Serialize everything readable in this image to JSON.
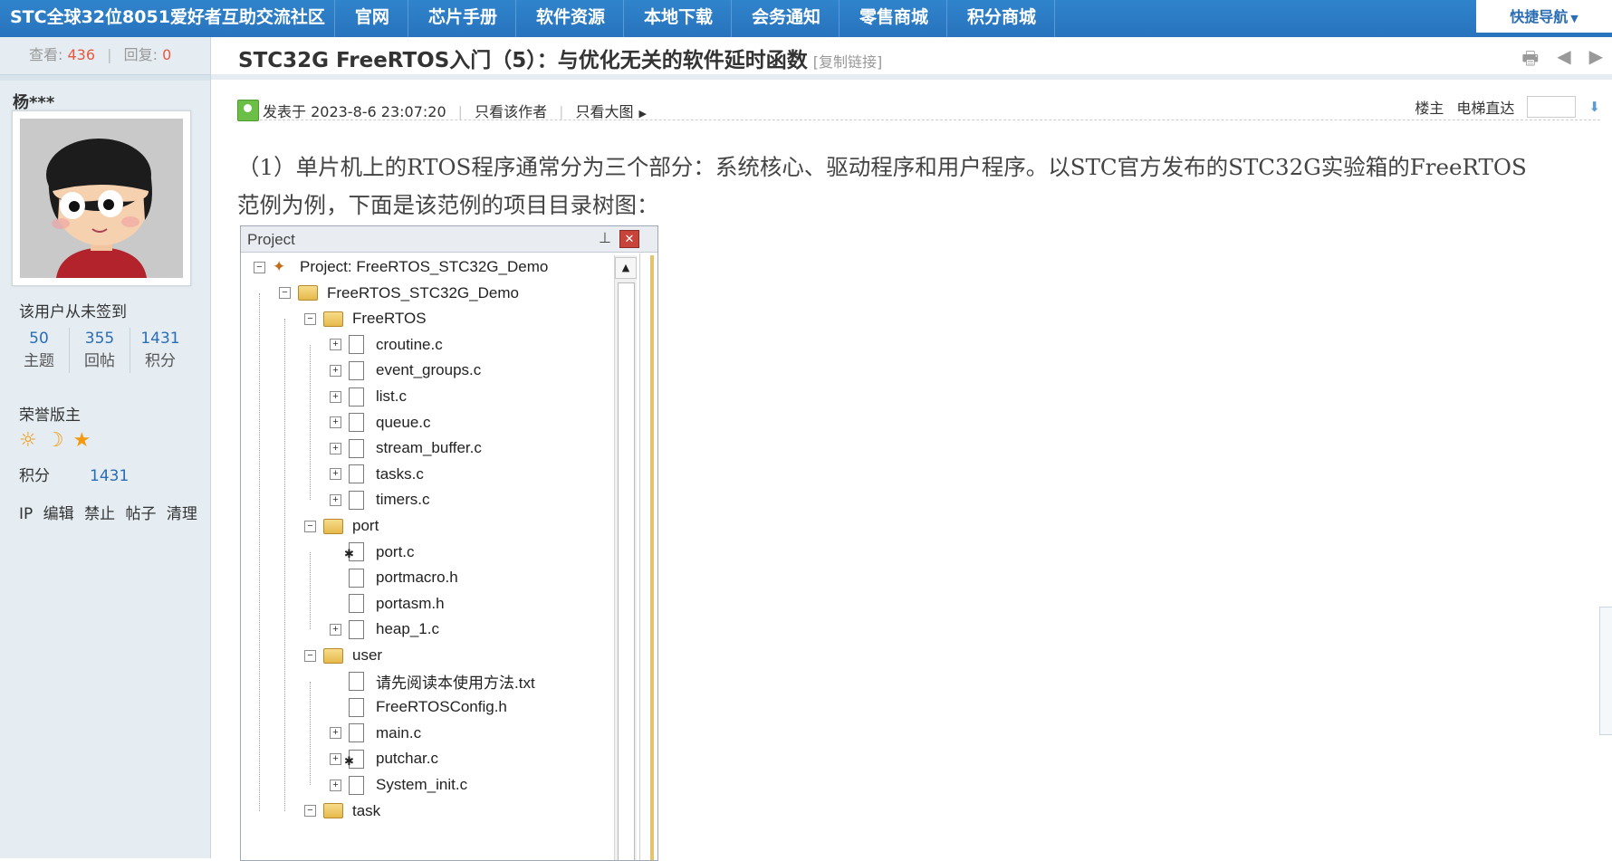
{
  "nav": {
    "site_name": "STC全球32位8051爱好者互助交流社区",
    "items": [
      {
        "label": "官网"
      },
      {
        "label": "芯片手册"
      },
      {
        "label": "软件资源"
      },
      {
        "label": "本地下载"
      },
      {
        "label": "会务通知"
      },
      {
        "label": "零售商城"
      },
      {
        "label": "积分商城"
      }
    ],
    "quick_nav": "快捷导航"
  },
  "thread_stats": {
    "views_label": "查看:",
    "views": "436",
    "replies_label": "回复:",
    "replies": "0"
  },
  "post": {
    "title": "STC32G FreeRTOS入门（5）：与优化无关的软件延时函数",
    "copy_link": "[复制链接]",
    "posted_at": "发表于 2023-8-6 23:07:20",
    "only_author": "只看该作者",
    "only_big_image": "只看大图",
    "floor_label": "楼主",
    "elevator_label": "电梯直达",
    "body_line1": "（1）单片机上的RTOS程序通常分为三个部分：系统核心、驱动程序和用户程序。以STC官方发布的STC32G实验箱的FreeRTOS",
    "body_line2": "范例为例，下面是该范例的项目目录树图："
  },
  "user": {
    "name": "杨***",
    "signin_status": "该用户从未签到",
    "counts": [
      {
        "value": "50",
        "label": "主题"
      },
      {
        "value": "355",
        "label": "回帖"
      },
      {
        "value": "1431",
        "label": "积分"
      }
    ],
    "rank": "荣誉版主",
    "points_label": "积分",
    "points": "1431",
    "admin_links": [
      "IP",
      "编辑",
      "禁止",
      "帖子",
      "清理"
    ]
  },
  "project_window": {
    "header": "Project",
    "rows": [
      {
        "text": "Project: FreeRTOS_STC32G_Demo",
        "kind": "project",
        "pm": "-"
      },
      {
        "text": "FreeRTOS_STC32G_Demo",
        "kind": "folder",
        "pm": "-"
      },
      {
        "text": "FreeRTOS",
        "kind": "folder",
        "pm": "-"
      },
      {
        "text": "croutine.c",
        "kind": "file",
        "pm": "+"
      },
      {
        "text": "event_groups.c",
        "kind": "file",
        "pm": "+"
      },
      {
        "text": "list.c",
        "kind": "file",
        "pm": "+"
      },
      {
        "text": "queue.c",
        "kind": "file",
        "pm": "+"
      },
      {
        "text": "stream_buffer.c",
        "kind": "file",
        "pm": "+"
      },
      {
        "text": "tasks.c",
        "kind": "file",
        "pm": "+"
      },
      {
        "text": "timers.c",
        "kind": "file",
        "pm": "+"
      },
      {
        "text": "port",
        "kind": "folder",
        "pm": "-"
      },
      {
        "text": "port.c",
        "kind": "file-gear",
        "pm": ""
      },
      {
        "text": "portmacro.h",
        "kind": "file",
        "pm": ""
      },
      {
        "text": "portasm.h",
        "kind": "file",
        "pm": ""
      },
      {
        "text": "heap_1.c",
        "kind": "file",
        "pm": "+"
      },
      {
        "text": "user",
        "kind": "folder",
        "pm": "-"
      },
      {
        "text": "请先阅读本使用方法.txt",
        "kind": "file",
        "pm": ""
      },
      {
        "text": "FreeRTOSConfig.h",
        "kind": "file",
        "pm": ""
      },
      {
        "text": "main.c",
        "kind": "file",
        "pm": "+"
      },
      {
        "text": "putchar.c",
        "kind": "file-gear",
        "pm": "+"
      },
      {
        "text": "System_init.c",
        "kind": "file",
        "pm": "+"
      },
      {
        "text": "task",
        "kind": "folder",
        "pm": "-"
      }
    ]
  },
  "colors": {
    "nav_bg": "#2a78c4",
    "sidebar_bg": "#e5edf2",
    "link_blue": "#2a6db5",
    "count_red": "#e8583f",
    "medal_orange": "#f39a12"
  }
}
